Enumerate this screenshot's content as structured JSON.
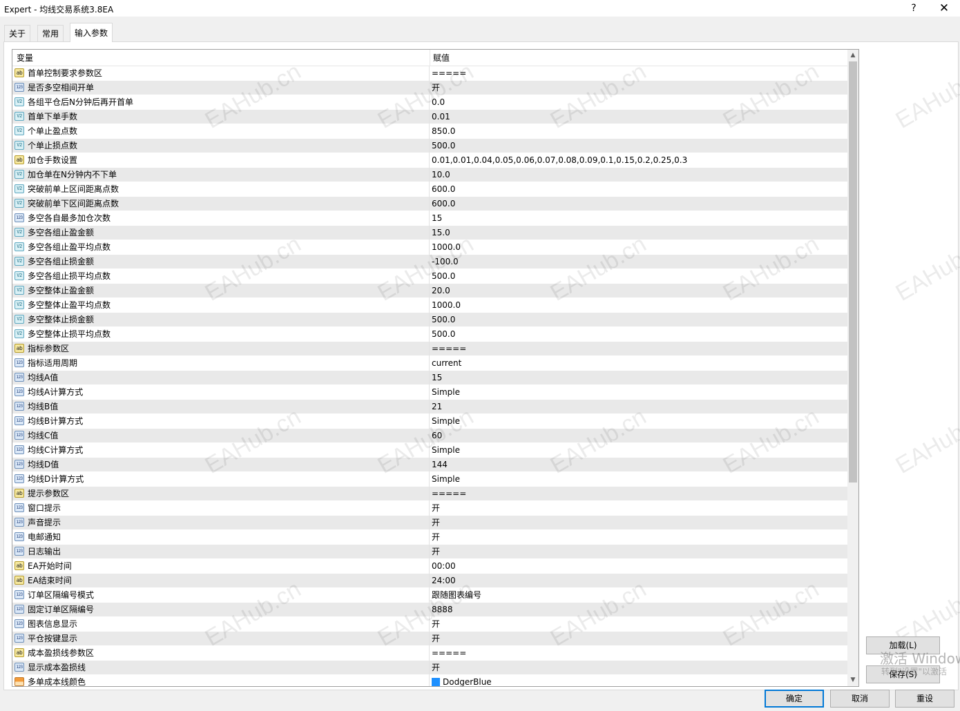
{
  "window": {
    "title": "Expert - 均线交易系统3.8EA",
    "help_label": "?",
    "close_label": "✕"
  },
  "tabs": [
    {
      "label": "关于"
    },
    {
      "label": "常用"
    },
    {
      "label": "输入参数"
    }
  ],
  "grid": {
    "headers": {
      "variable": "变量",
      "value": "赋值"
    },
    "rows": [
      {
        "icon": "ab",
        "name": "首单控制要求参数区",
        "value": "====="
      },
      {
        "icon": "123",
        "name": "是否多空相间开单",
        "value": "开"
      },
      {
        "icon": "v2",
        "name": "各组平仓后N分钟后再开首单",
        "value": "0.0"
      },
      {
        "icon": "v2",
        "name": "首单下单手数",
        "value": "0.01"
      },
      {
        "icon": "v2",
        "name": "个单止盈点数",
        "value": "850.0"
      },
      {
        "icon": "v2",
        "name": "个单止损点数",
        "value": "500.0"
      },
      {
        "icon": "ab",
        "name": "加仓手数设置",
        "value": "0.01,0.01,0.04,0.05,0.06,0.07,0.08,0.09,0.1,0.15,0.2,0.25,0.3"
      },
      {
        "icon": "v2",
        "name": "加仓单在N分钟内不下单",
        "value": "10.0"
      },
      {
        "icon": "v2",
        "name": "突破前单上区间距离点数",
        "value": "600.0"
      },
      {
        "icon": "v2",
        "name": "突破前单下区间距离点数",
        "value": "600.0"
      },
      {
        "icon": "123",
        "name": "多空各自最多加仓次数",
        "value": "15"
      },
      {
        "icon": "v2",
        "name": "多空各组止盈金额",
        "value": "15.0"
      },
      {
        "icon": "v2",
        "name": "多空各组止盈平均点数",
        "value": "1000.0"
      },
      {
        "icon": "v2",
        "name": "多空各组止损金额",
        "value": "-100.0"
      },
      {
        "icon": "v2",
        "name": "多空各组止损平均点数",
        "value": "500.0"
      },
      {
        "icon": "v2",
        "name": "多空整体止盈金额",
        "value": "20.0"
      },
      {
        "icon": "v2",
        "name": "多空整体止盈平均点数",
        "value": "1000.0"
      },
      {
        "icon": "v2",
        "name": "多空整体止损金额",
        "value": "500.0"
      },
      {
        "icon": "v2",
        "name": "多空整体止损平均点数",
        "value": "500.0"
      },
      {
        "icon": "ab",
        "name": "指标参数区",
        "value": "====="
      },
      {
        "icon": "123",
        "name": "指标适用周期",
        "value": "current"
      },
      {
        "icon": "123",
        "name": "均线A值",
        "value": "15"
      },
      {
        "icon": "123",
        "name": "均线A计算方式",
        "value": "Simple"
      },
      {
        "icon": "123",
        "name": "均线B值",
        "value": "21"
      },
      {
        "icon": "123",
        "name": "均线B计算方式",
        "value": "Simple"
      },
      {
        "icon": "123",
        "name": "均线C值",
        "value": "60"
      },
      {
        "icon": "123",
        "name": "均线C计算方式",
        "value": "Simple"
      },
      {
        "icon": "123",
        "name": "均线D值",
        "value": "144"
      },
      {
        "icon": "123",
        "name": "均线D计算方式",
        "value": "Simple"
      },
      {
        "icon": "ab",
        "name": "提示参数区",
        "value": "====="
      },
      {
        "icon": "123",
        "name": "窗口提示",
        "value": "开"
      },
      {
        "icon": "123",
        "name": "声音提示",
        "value": "开"
      },
      {
        "icon": "123",
        "name": "电邮通知",
        "value": "开"
      },
      {
        "icon": "123",
        "name": "日志输出",
        "value": "开"
      },
      {
        "icon": "ab",
        "name": "EA开始时间",
        "value": "00:00"
      },
      {
        "icon": "ab",
        "name": "EA结束时间",
        "value": "24:00"
      },
      {
        "icon": "123",
        "name": "订单区隔编号模式",
        "value": "跟随图表编号"
      },
      {
        "icon": "123",
        "name": "固定订单区隔编号",
        "value": "8888"
      },
      {
        "icon": "123",
        "name": "图表信息显示",
        "value": "开"
      },
      {
        "icon": "123",
        "name": "平仓按键显示",
        "value": "开"
      },
      {
        "icon": "ab",
        "name": "成本盈损线参数区",
        "value": "====="
      },
      {
        "icon": "123",
        "name": "显示成本盈损线",
        "value": "开"
      },
      {
        "icon": "color",
        "name": "多单成本线颜色",
        "value": "DodgerBlue",
        "swatch": "#1e90ff"
      }
    ]
  },
  "side_buttons": {
    "load": "加载(L)",
    "save": "保存(S)"
  },
  "bottom_buttons": {
    "ok": "确定",
    "cancel": "取消",
    "reset": "重设"
  },
  "watermark": "EAHub.cn",
  "activation": {
    "line1": "激活 Windows",
    "line2": "转到\"设置\"以激活"
  },
  "colors": {
    "accent": "#0078d7",
    "swatch_dodgerblue": "#1e90ff"
  }
}
